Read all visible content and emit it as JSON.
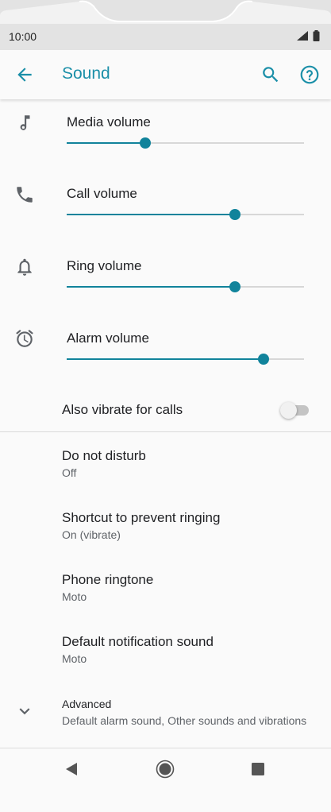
{
  "status_bar": {
    "time": "10:00",
    "signal_icon": "signal-icon",
    "battery_icon": "battery-icon"
  },
  "app_bar": {
    "title": "Sound",
    "back_icon": "arrow-back-icon",
    "search_icon": "search-icon",
    "help_icon": "help-icon",
    "accent_color": "#1a8fa8"
  },
  "volumes": [
    {
      "label": "Media volume",
      "icon": "music-note-icon",
      "level": 0.33
    },
    {
      "label": "Call volume",
      "icon": "phone-icon",
      "level": 0.71
    },
    {
      "label": "Ring volume",
      "icon": "bell-icon",
      "level": 0.71
    },
    {
      "label": "Alarm volume",
      "icon": "alarm-clock-icon",
      "level": 0.83
    }
  ],
  "vibrate": {
    "label": "Also vibrate for calls",
    "enabled": false
  },
  "prefs": [
    {
      "title": "Do not disturb",
      "subtitle": "Off"
    },
    {
      "title": "Shortcut to prevent ringing",
      "subtitle": "On (vibrate)"
    },
    {
      "title": "Phone ringtone",
      "subtitle": "Moto"
    },
    {
      "title": "Default notification sound",
      "subtitle": "Moto"
    }
  ],
  "advanced": {
    "title": "Advanced",
    "subtitle": "Default alarm sound, Other sounds and vibrations",
    "icon": "chevron-down-icon"
  },
  "nav_bar": {
    "back": "nav-back-icon",
    "home": "nav-home-icon",
    "recents": "nav-recents-icon"
  }
}
